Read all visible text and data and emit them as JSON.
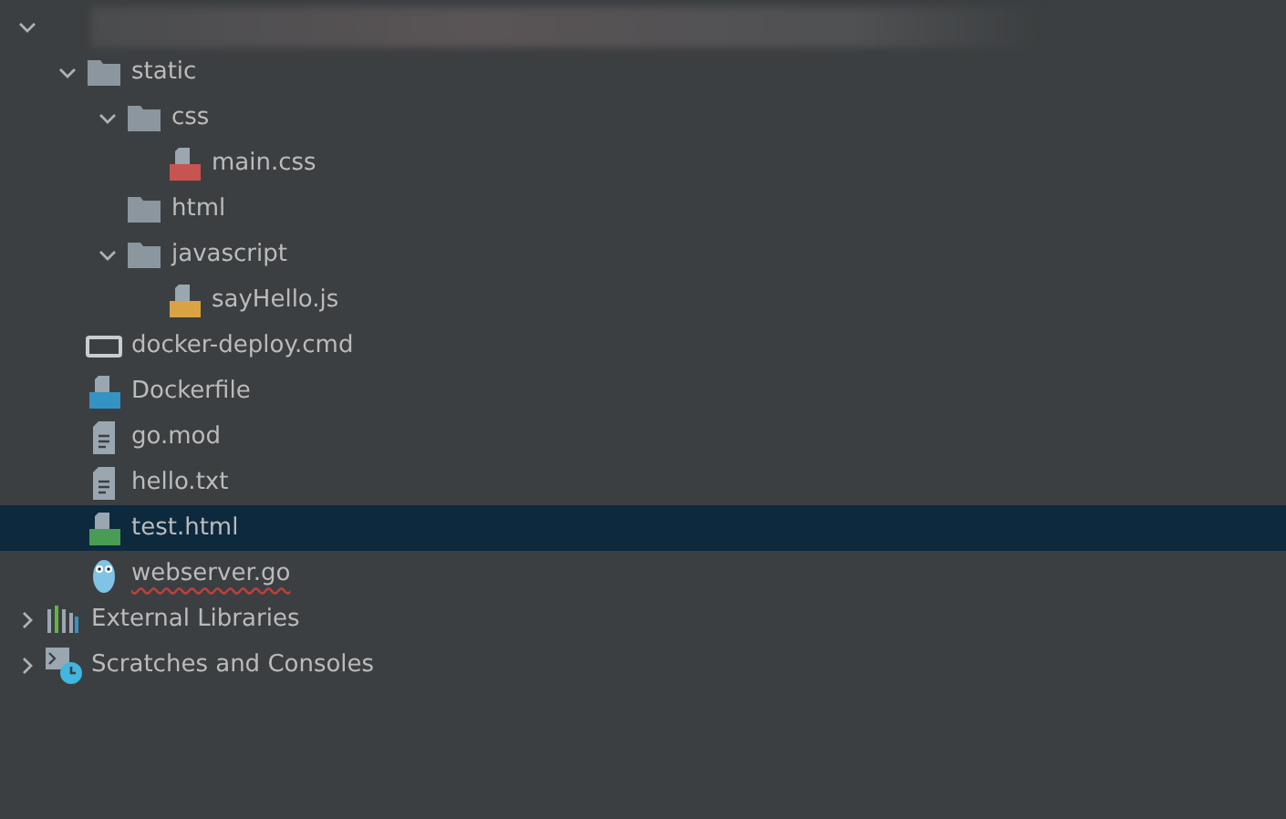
{
  "tree": [
    {
      "kind": "project",
      "expanded": true,
      "selected": false,
      "children": [
        {
          "label": "static",
          "kind": "folder",
          "expanded": true,
          "selected": false,
          "error": false,
          "children": [
            {
              "label": "css",
              "kind": "folder",
              "expanded": true,
              "selected": false,
              "error": false,
              "children": [
                {
                  "label": "main.css",
                  "kind": "css",
                  "selected": false,
                  "error": false
                }
              ]
            },
            {
              "label": "html",
              "kind": "folder",
              "selected": false,
              "error": false
            },
            {
              "label": "javascript",
              "kind": "folder",
              "expanded": true,
              "selected": false,
              "error": false,
              "children": [
                {
                  "label": "sayHello.js",
                  "kind": "js",
                  "selected": false,
                  "error": false
                }
              ]
            }
          ]
        },
        {
          "label": "docker-deploy.cmd",
          "kind": "cmd",
          "selected": false,
          "error": false
        },
        {
          "label": "Dockerfile",
          "kind": "docker",
          "selected": false,
          "error": false
        },
        {
          "label": "go.mod",
          "kind": "text",
          "selected": false,
          "error": false
        },
        {
          "label": "hello.txt",
          "kind": "text",
          "selected": false,
          "error": false
        },
        {
          "label": "test.html",
          "kind": "html",
          "selected": true,
          "error": false
        },
        {
          "label": "webserver.go",
          "kind": "go",
          "selected": false,
          "error": true
        }
      ]
    },
    {
      "label": "External Libraries",
      "kind": "libraries",
      "expanded": false,
      "selected": false
    },
    {
      "label": "Scratches and Consoles",
      "kind": "scratches",
      "expanded": false,
      "selected": false
    }
  ]
}
